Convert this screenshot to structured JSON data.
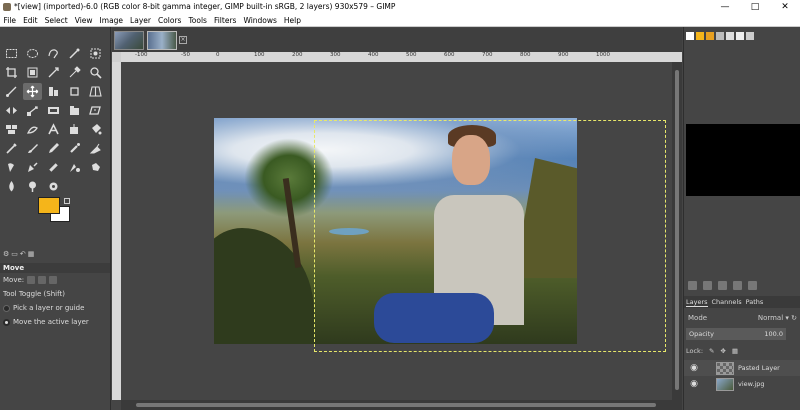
{
  "window": {
    "title": "*[view] (imported)-6.0 (RGB color 8-bit gamma integer, GIMP built-in sRGB, 2 layers) 930x579 – GIMP",
    "minimize": "—",
    "maximize": "□",
    "close": "✕"
  },
  "menu": [
    "File",
    "Edit",
    "Select",
    "View",
    "Image",
    "Layer",
    "Colors",
    "Tools",
    "Filters",
    "Windows",
    "Help"
  ],
  "colors": {
    "foreground": "#f5b51a",
    "background": "#ffffff",
    "selection": "#e8e86a"
  },
  "ruler_top_ticks": [
    "-100",
    "-50",
    "0",
    "100",
    "200",
    "300",
    "400",
    "500",
    "600",
    "700",
    "800",
    "900",
    "1000"
  ],
  "tool_options": {
    "title": "Move",
    "move_label": "Move:",
    "toggle_label": "Tool Toggle  (Shift)",
    "option1": "Pick a layer or guide",
    "option2": "Move the active layer"
  },
  "layers_panel": {
    "tabs": [
      "Layers",
      "Channels",
      "Paths"
    ],
    "mode_label": "Mode",
    "mode_value": "Normal",
    "opacity_label": "Opacity",
    "opacity_value": "100.0",
    "lock_label": "Lock:",
    "layers": [
      {
        "name": "Pasted Layer",
        "visible": true,
        "selected": true
      },
      {
        "name": "view.jpg",
        "visible": true,
        "selected": false
      }
    ]
  }
}
